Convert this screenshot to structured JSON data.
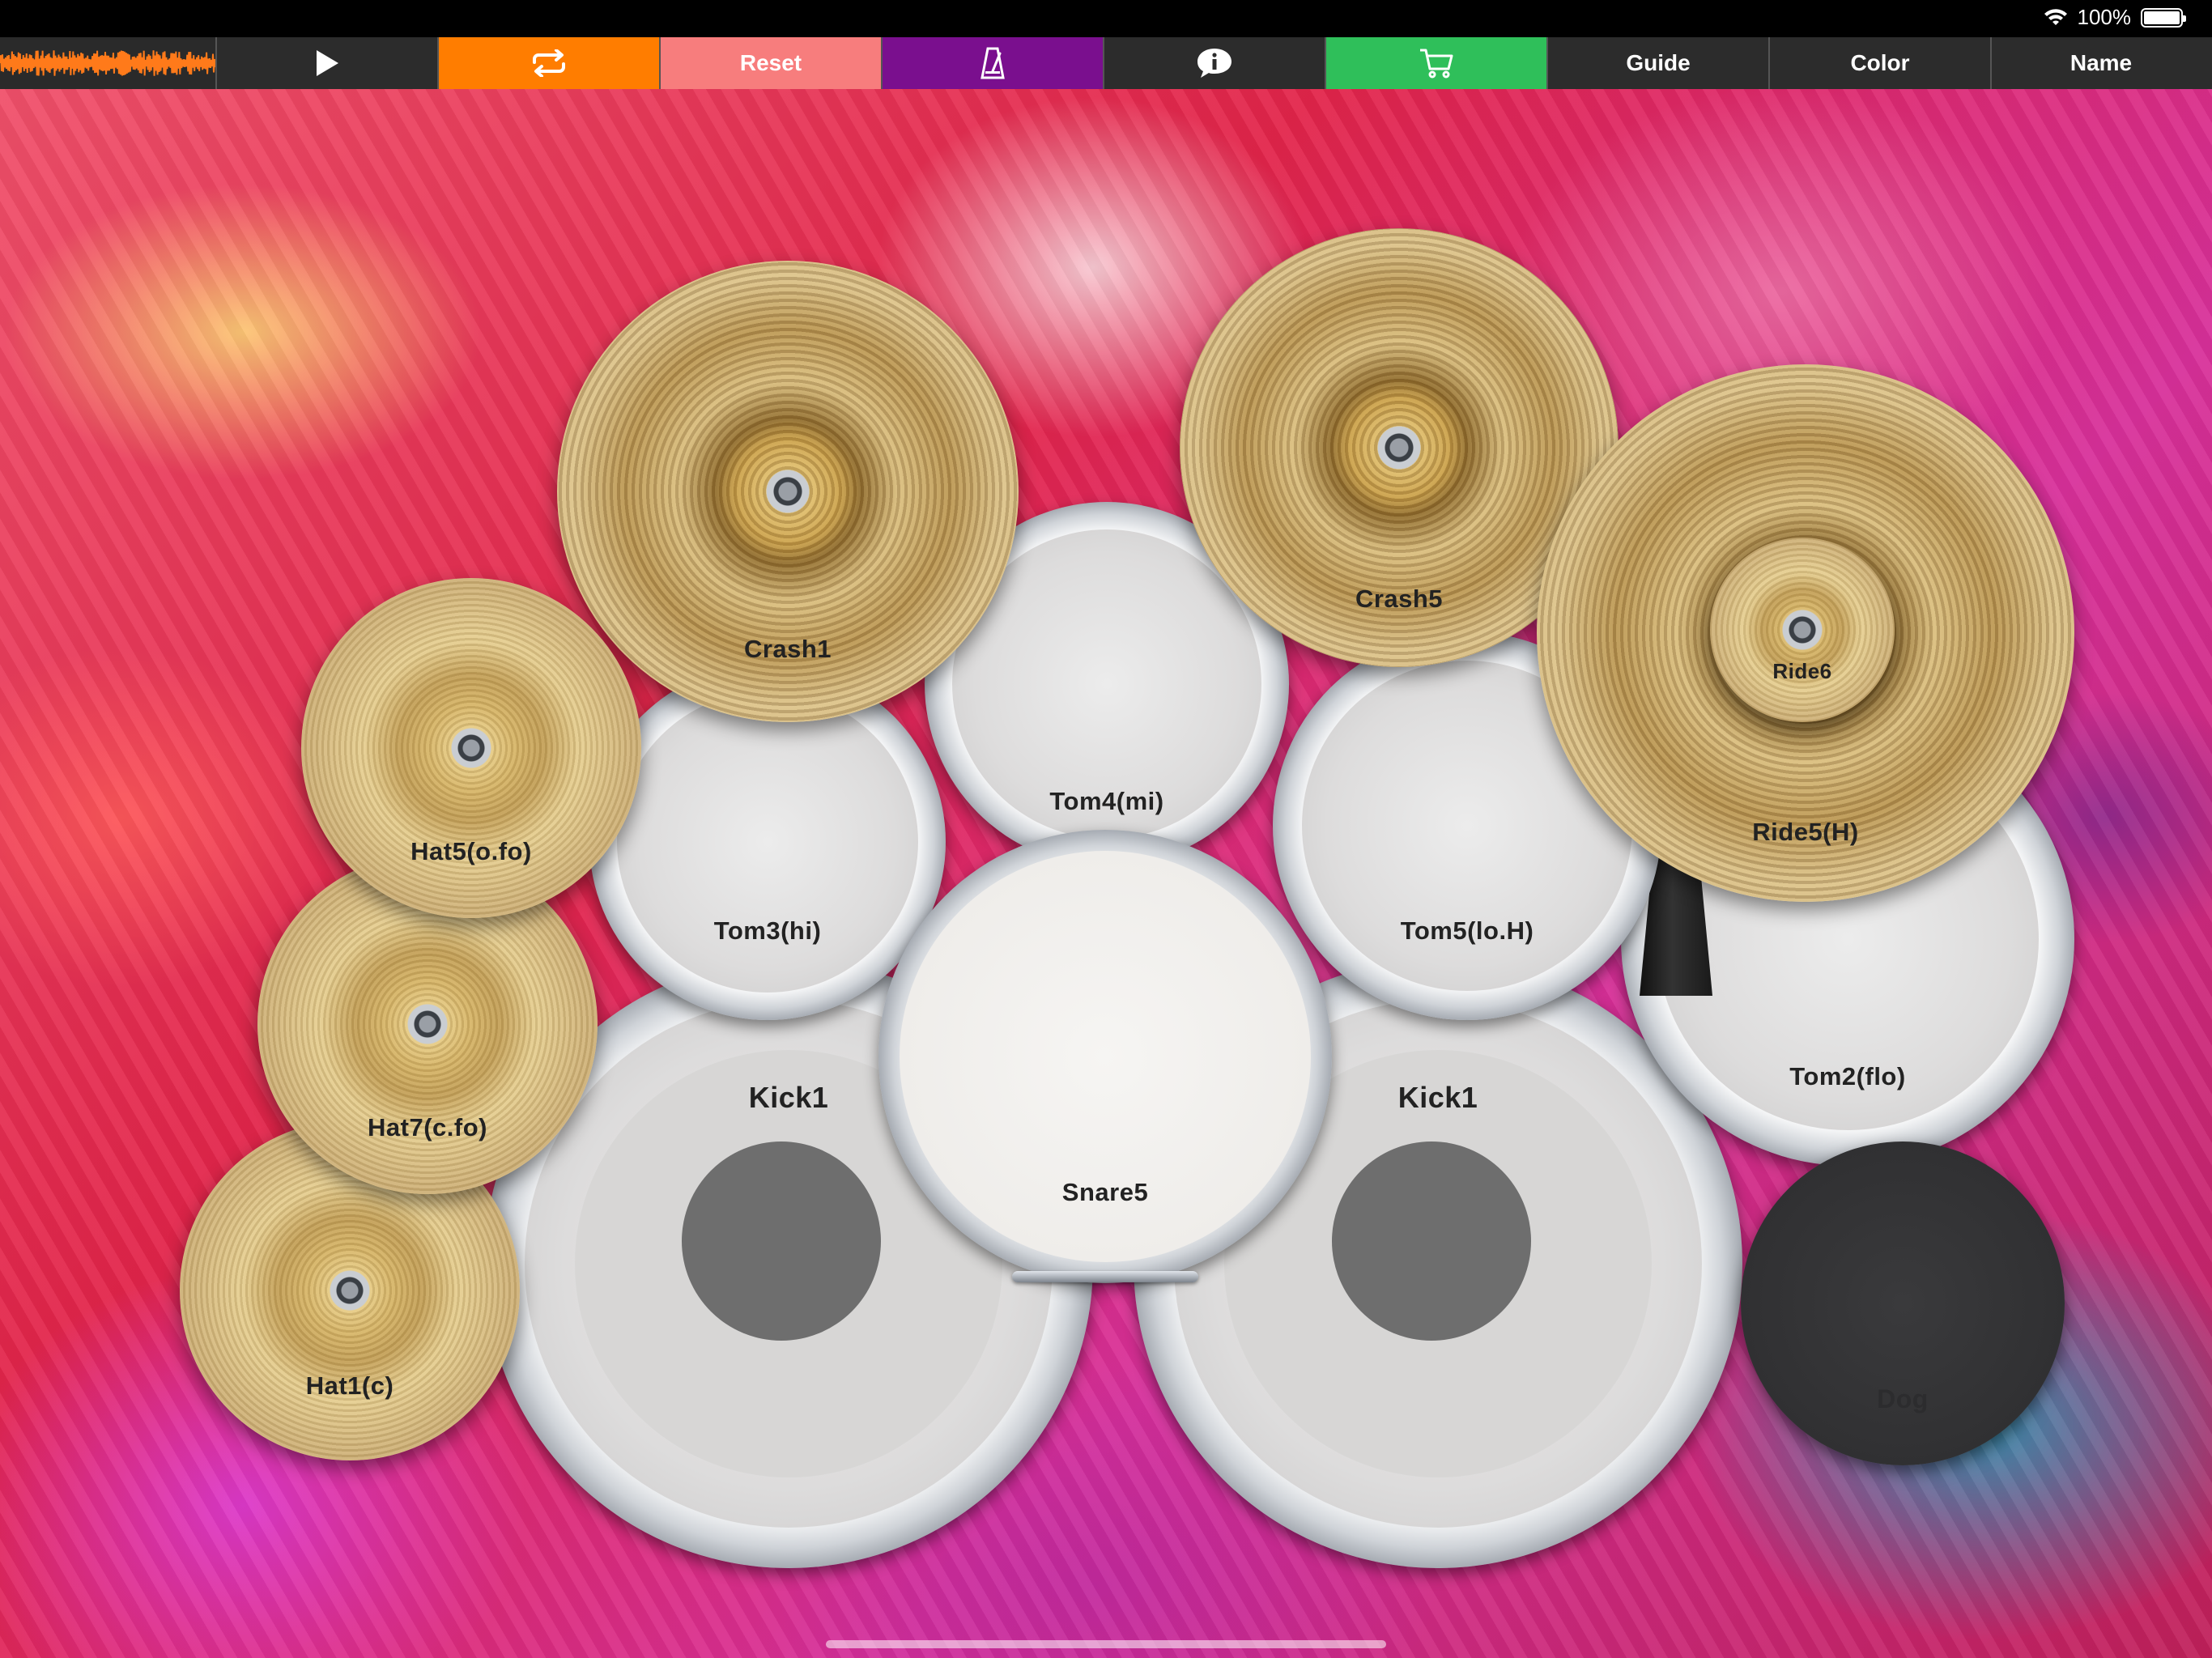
{
  "status_bar": {
    "wifi_icon": "wifi-icon",
    "battery_percent": "100%",
    "battery_level": 1.0
  },
  "toolbar": {
    "waveform_icon": "waveform-icon",
    "play_icon": "play-icon",
    "loop_icon": "loop-icon",
    "reset_label": "Reset",
    "metronome_icon": "metronome-icon",
    "info_icon": "info-icon",
    "cart_icon": "cart-icon",
    "guide_label": "Guide",
    "color_label": "Color",
    "name_label": "Name",
    "colors": {
      "background": "#2c2c2c",
      "waveform": "#ff7a1a",
      "loop": "#ff7d00",
      "reset": "#f77d7d",
      "metronome": "#7a0f8e",
      "cart": "#2fbf5a"
    }
  },
  "kit": {
    "crash1": "Crash1",
    "crash5": "Crash5",
    "ride6": "Ride6",
    "ride5": "Ride5(H)",
    "hat5": "Hat5(o.fo)",
    "hat7": "Hat7(c.fo)",
    "hat1": "Hat1(c)",
    "tom3": "Tom3(hi)",
    "tom4": "Tom4(mi)",
    "tom5": "Tom5(lo.H)",
    "tom2": "Tom2(flo)",
    "kick_left": "Kick1",
    "kick_right": "Kick1",
    "snare": "Snare5",
    "dog": "Dog",
    "dog_ring_color": "#2f8cff"
  }
}
